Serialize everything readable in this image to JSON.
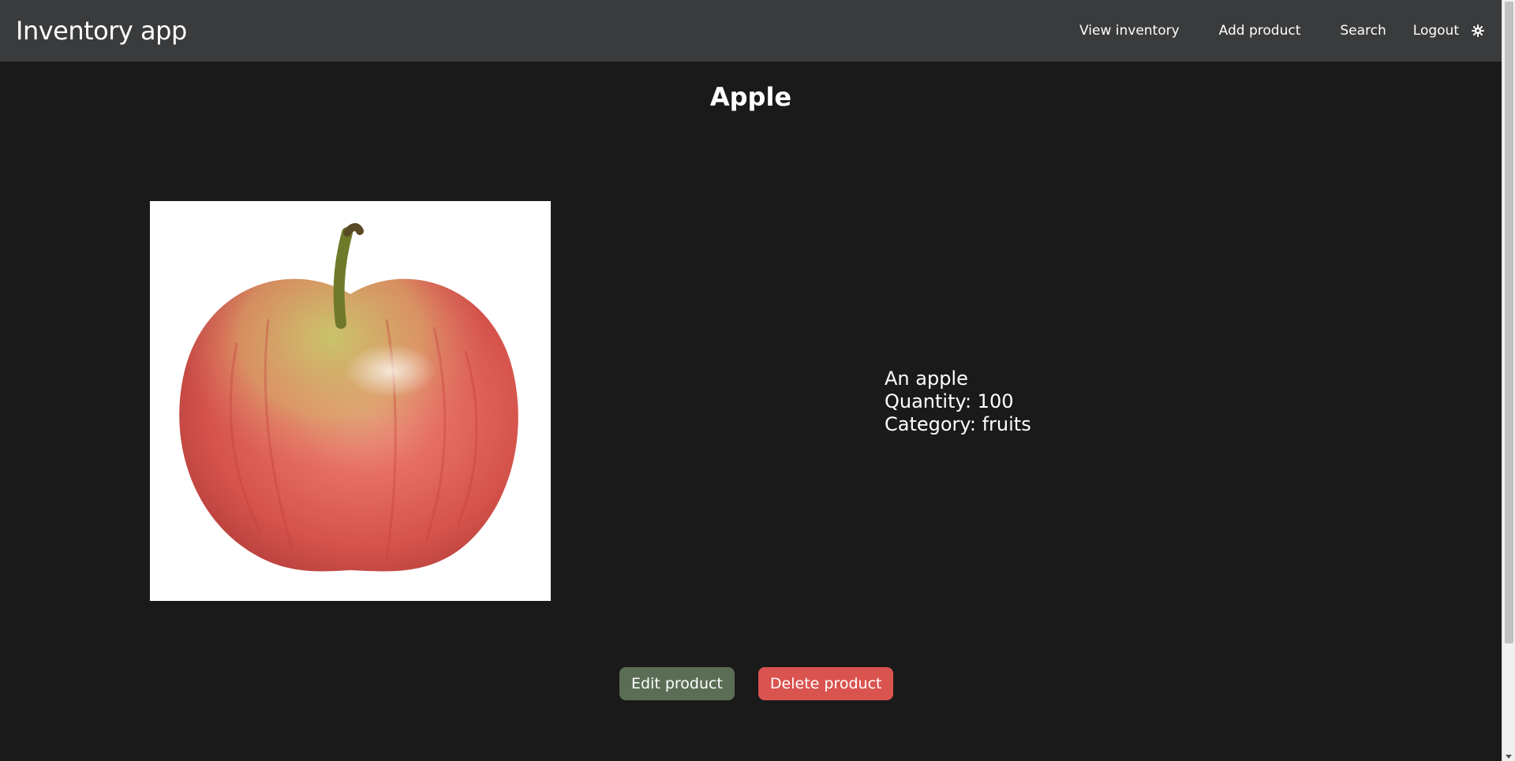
{
  "navbar": {
    "brand": "Inventory app",
    "links": [
      "View inventory",
      "Add product",
      "Search",
      "Logout"
    ],
    "theme_icon": "gear-icon"
  },
  "product": {
    "name": "Apple",
    "image_icon": "apple-image",
    "description": "An apple",
    "quantity": "Quantity: 100",
    "category": "Category: fruits"
  },
  "actions": {
    "edit_label": "Edit product",
    "delete_label": "Delete product"
  },
  "colors": {
    "background": "#1a1a1a",
    "navbar": "#3a3b3c",
    "edit_button": "#5b6e55",
    "delete_button": "#d9534f"
  }
}
